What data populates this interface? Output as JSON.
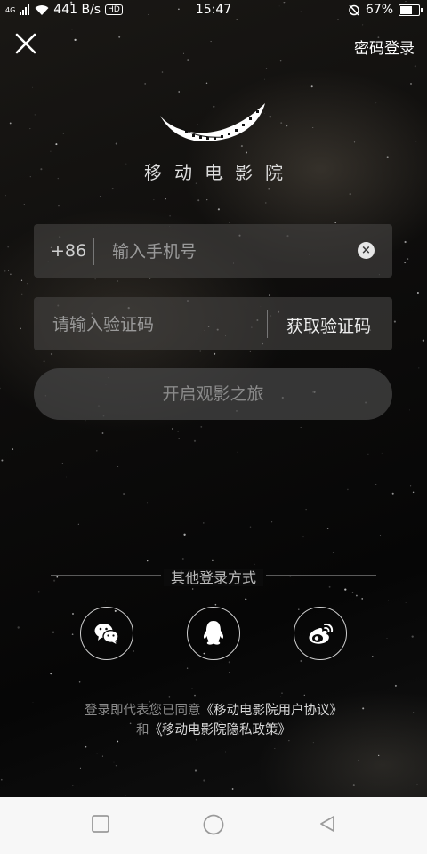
{
  "status_bar": {
    "network": "4G",
    "speed": "441 B/s",
    "volte": "HD",
    "time": "15:47",
    "battery": "67%",
    "battery_level": 0.67
  },
  "header": {
    "close_icon": "close-icon",
    "password_login": "密码登录"
  },
  "brand": {
    "logo_icon": "film-smile-logo",
    "app_name": "移动电影院"
  },
  "form": {
    "country_code": "+86",
    "phone_placeholder": "输入手机号",
    "phone_value": "",
    "code_placeholder": "请输入验证码",
    "code_value": "",
    "get_code_label": "获取验证码",
    "clear_icon": "clear-icon"
  },
  "submit": {
    "label": "开启观影之旅"
  },
  "other_login": {
    "label": "其他登录方式",
    "methods": [
      {
        "name": "wechat",
        "icon": "wechat-icon"
      },
      {
        "name": "qq",
        "icon": "qq-icon"
      },
      {
        "name": "weibo",
        "icon": "weibo-icon"
      }
    ]
  },
  "agreement": {
    "prefix": "登录即代表您已同意",
    "user_agreement": "《移动电影院用户协议》",
    "conjunction": "和",
    "privacy_policy": "《移动电影院隐私政策》"
  },
  "nav_bar": {
    "items": [
      {
        "name": "recent-apps",
        "icon": "square-icon"
      },
      {
        "name": "home",
        "icon": "circle-icon"
      },
      {
        "name": "back",
        "icon": "back-triangle-icon"
      }
    ]
  },
  "colors": {
    "background": "#0b0b0b",
    "field": "#464442",
    "text_primary": "#ffffff",
    "text_muted": "#9a9a9a",
    "navbar": "#f7f7f7"
  }
}
